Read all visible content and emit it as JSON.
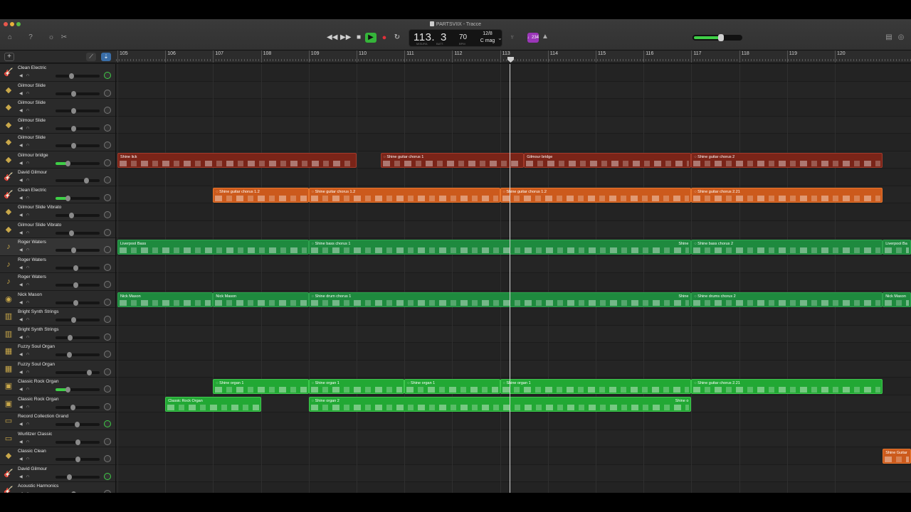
{
  "window": {
    "title": "PARTSVIIX - Tracce"
  },
  "lcd": {
    "bar": "113.",
    "beat": "3",
    "tempo": "70",
    "time_signature": "12/8",
    "key": "C mag",
    "label_bar": "MISURA",
    "label_beat": "BATT.",
    "label_tempo": "BPM"
  },
  "count_in": "♩234",
  "master_volume": 0.6,
  "ruler": {
    "bars": [
      "105",
      "106",
      "107",
      "108",
      "109",
      "110",
      "111",
      "112",
      "113",
      "114",
      "115",
      "116",
      "117",
      "118",
      "119",
      "120"
    ]
  },
  "tracks": [
    {
      "name": "Clean Electric",
      "icon": "guitar-icon",
      "volume": 0.35,
      "pan_active": true
    },
    {
      "name": "Gilmour Slide",
      "icon": "pedal-icon",
      "volume": 0.4,
      "pan_active": false
    },
    {
      "name": "Gilmour Slide",
      "icon": "pedal-icon",
      "volume": 0.4,
      "pan_active": false
    },
    {
      "name": "Gilmour Slide",
      "icon": "pedal-icon",
      "volume": 0.4,
      "pan_active": false
    },
    {
      "name": "Gilmour Slide",
      "icon": "pedal-icon",
      "volume": 0.4,
      "pan_active": false
    },
    {
      "name": "Gilmour bridge",
      "icon": "pedal-icon",
      "volume": 0.28,
      "pan_active": false
    },
    {
      "name": "David Gilmour",
      "icon": "guitar-icon",
      "volume": 0.7,
      "pan_active": false
    },
    {
      "name": "Clean Electric",
      "icon": "guitar-icon",
      "volume": 0.28,
      "pan_active": false
    },
    {
      "name": "Gilmour Slide Vibrato",
      "icon": "pedal-icon",
      "volume": 0.35,
      "pan_active": false
    },
    {
      "name": "Gilmour Slide Vibrato",
      "icon": "pedal-icon",
      "volume": 0.35,
      "pan_active": false
    },
    {
      "name": "Roger Waters",
      "icon": "bass-icon",
      "volume": 0.4,
      "pan_active": false
    },
    {
      "name": "Roger Waters",
      "icon": "bass-icon",
      "volume": 0.45,
      "pan_active": false
    },
    {
      "name": "Roger Waters",
      "icon": "bass-icon",
      "volume": 0.45,
      "pan_active": false
    },
    {
      "name": "Nick Mason",
      "icon": "drums-icon",
      "volume": 0.45,
      "pan_active": false
    },
    {
      "name": "Bright Synth Strings",
      "icon": "keyboard-icon",
      "volume": 0.4,
      "pan_active": false
    },
    {
      "name": "Bright Synth Strings",
      "icon": "keyboard-icon",
      "volume": 0.33,
      "pan_active": false
    },
    {
      "name": "Fuzzy Soul Organ",
      "icon": "organ-icon",
      "volume": 0.3,
      "pan_active": false
    },
    {
      "name": "Fuzzy Soul Organ",
      "icon": "organ-icon",
      "volume": 0.75,
      "pan_active": false
    },
    {
      "name": "Classic Rock Organ",
      "icon": "amp-icon",
      "volume": 0.28,
      "pan_active": false
    },
    {
      "name": "Classic Rock Organ",
      "icon": "amp-icon",
      "volume": 0.38,
      "pan_active": false
    },
    {
      "name": "Record Collection Grand",
      "icon": "piano-icon",
      "volume": 0.48,
      "pan_active": true
    },
    {
      "name": "Wurlitzer Classic",
      "icon": "piano-icon",
      "volume": 0.5,
      "pan_active": false
    },
    {
      "name": "Classic Clean",
      "icon": "pedal-icon",
      "volume": 0.5,
      "pan_active": false
    },
    {
      "name": "David Gilmour",
      "icon": "guitar-icon",
      "volume": 0.3,
      "pan_active": true
    },
    {
      "name": "Acoustic Harmonics",
      "icon": "guitar-icon",
      "volume": 0.4,
      "pan_active": false
    }
  ],
  "regions": [
    {
      "lane": 5,
      "start": 105.0,
      "end": 110.0,
      "label": "Shine lick",
      "color": "red"
    },
    {
      "lane": 5,
      "start": 110.5,
      "end": 113.5,
      "label": "◌ Shine guitar chorus 1",
      "color": "red"
    },
    {
      "lane": 5,
      "start": 113.5,
      "end": 117.0,
      "label": "Gilmour bridge",
      "color": "red"
    },
    {
      "lane": 5,
      "start": 117.0,
      "end": 121.0,
      "label": "◌ Shine guitar chorus 2",
      "color": "red"
    },
    {
      "lane": 7,
      "start": 107.0,
      "end": 109.0,
      "label": "◌ Shine guitar chorus 1.2",
      "color": "orange"
    },
    {
      "lane": 7,
      "start": 109.0,
      "end": 113.0,
      "label": "◌ Shine guitar chorus 1.2",
      "color": "orange"
    },
    {
      "lane": 7,
      "start": 113.0,
      "end": 117.0,
      "label": "◌ Shine guitar chorus 1.2",
      "color": "orange"
    },
    {
      "lane": 7,
      "start": 117.0,
      "end": 121.0,
      "label": "◌ Shine guitar chorus 2.21",
      "color": "orange"
    },
    {
      "lane": 10,
      "start": 105.0,
      "end": 109.0,
      "label": "Liverpool Bass",
      "color": "green-dark"
    },
    {
      "lane": 10,
      "start": 109.0,
      "end": 117.0,
      "label": "◌ Shine bass chorus 1",
      "label_right": "Shine",
      "color": "green-dark"
    },
    {
      "lane": 10,
      "start": 117.0,
      "end": 121.0,
      "label": "◌ Shine bass chorus 2",
      "color": "green-dark"
    },
    {
      "lane": 10,
      "start": 121.0,
      "end": 122.0,
      "label": "Liverpool Ba",
      "color": "green-dark"
    },
    {
      "lane": 13,
      "start": 105.0,
      "end": 107.0,
      "label": "Nick Mason",
      "color": "green-dark"
    },
    {
      "lane": 13,
      "start": 107.0,
      "end": 109.0,
      "label": "Nick Mason",
      "color": "green-dark"
    },
    {
      "lane": 13,
      "start": 109.0,
      "end": 117.0,
      "label": "◌ Shine drum chorus 1",
      "label_right": "Shine",
      "color": "green-dark"
    },
    {
      "lane": 13,
      "start": 117.0,
      "end": 121.0,
      "label": "◌ Shine drums chorus 2",
      "color": "green-dark"
    },
    {
      "lane": 13,
      "start": 121.0,
      "end": 122.0,
      "label": "Nick Mason",
      "color": "green-dark"
    },
    {
      "lane": 18,
      "start": 107.0,
      "end": 109.0,
      "label": "◌ Shine organ 1",
      "color": "green"
    },
    {
      "lane": 18,
      "start": 109.0,
      "end": 111.0,
      "label": "◌ Shine organ 1",
      "color": "green"
    },
    {
      "lane": 18,
      "start": 111.0,
      "end": 113.0,
      "label": "◌ Shine organ 1",
      "color": "green"
    },
    {
      "lane": 18,
      "start": 113.0,
      "end": 117.0,
      "label": "◌ Shine organ 1",
      "color": "green"
    },
    {
      "lane": 18,
      "start": 117.0,
      "end": 121.0,
      "label": "◌ Shine guitar chorus 2.21",
      "color": "green"
    },
    {
      "lane": 19,
      "start": 106.0,
      "end": 108.0,
      "label": "Classic Rock Organ",
      "color": "green"
    },
    {
      "lane": 19,
      "start": 109.0,
      "end": 117.0,
      "label": "◌ Shine organ 2",
      "label_right": "Shine o",
      "color": "green"
    },
    {
      "lane": 22,
      "start": 121.0,
      "end": 122.0,
      "label": "Shine Guitar",
      "color": "orange"
    }
  ],
  "playhead_bar": 113.2,
  "colors": {
    "red": "#7a2418",
    "orange": "#cc5a1c",
    "green-dark": "#1e8a3e",
    "green": "#22a834",
    "accent": "#3fcf47"
  }
}
